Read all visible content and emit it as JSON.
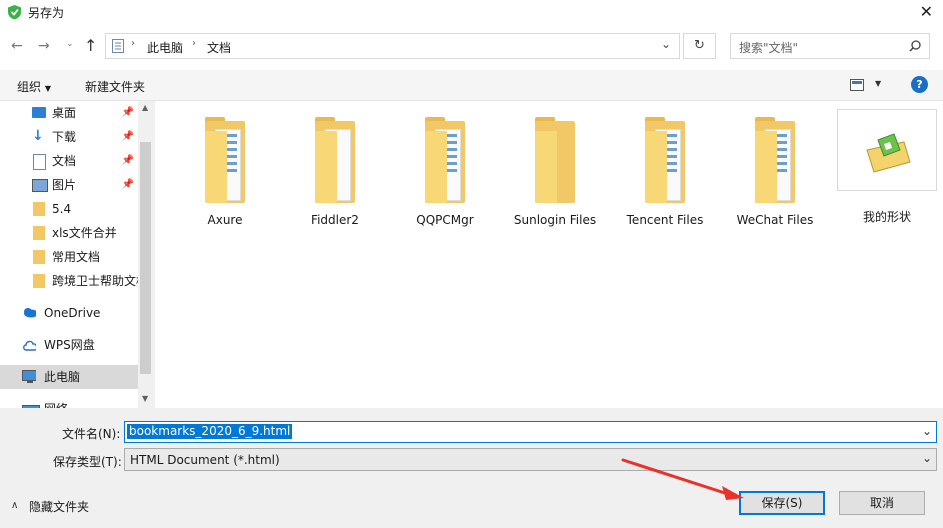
{
  "window": {
    "title": "另存为"
  },
  "nav": {
    "breadcrumb": [
      "此电脑",
      "文档"
    ],
    "search_placeholder": "搜索\"文档\""
  },
  "toolbar": {
    "organize": "组织",
    "new_folder": "新建文件夹"
  },
  "sidebar": {
    "items": [
      {
        "label": "桌面",
        "icon": "desktop-icon",
        "pinned": true
      },
      {
        "label": "下载",
        "icon": "download-icon",
        "pinned": true
      },
      {
        "label": "文档",
        "icon": "document-icon",
        "pinned": true
      },
      {
        "label": "图片",
        "icon": "picture-icon",
        "pinned": true
      },
      {
        "label": "5.4",
        "icon": "folder-icon",
        "pinned": false
      },
      {
        "label": "xls文件合并",
        "icon": "folder-icon",
        "pinned": false
      },
      {
        "label": "常用文档",
        "icon": "folder-icon",
        "pinned": false
      },
      {
        "label": "跨境卫士帮助文档",
        "icon": "folder-icon",
        "pinned": false
      },
      {
        "label": "OneDrive",
        "icon": "onedrive-icon",
        "pinned": false
      },
      {
        "label": "WPS网盘",
        "icon": "wps-cloud-icon",
        "pinned": false
      },
      {
        "label": "此电脑",
        "icon": "this-pc-icon",
        "pinned": false,
        "selected": true
      },
      {
        "label": "网络",
        "icon": "network-icon",
        "pinned": false
      }
    ]
  },
  "files": [
    {
      "name": "Axure",
      "type": "folder-docs"
    },
    {
      "name": "Fiddler2",
      "type": "folder-blank"
    },
    {
      "name": "QQPCMgr",
      "type": "folder-docs"
    },
    {
      "name": "Sunlogin Files",
      "type": "folder-empty"
    },
    {
      "name": "Tencent Files",
      "type": "folder-docs"
    },
    {
      "name": "WeChat Files",
      "type": "folder-docs"
    },
    {
      "name": "我的形状",
      "type": "shapes-folder"
    }
  ],
  "form": {
    "filename_label": "文件名(N):",
    "filename_value": "bookmarks_2020_6_9.html",
    "filetype_label": "保存类型(T):",
    "filetype_value": "HTML Document (*.html)",
    "hide_folders": "隐藏文件夹",
    "save": "保存(S)",
    "cancel": "取消"
  },
  "colors": {
    "accent": "#0078d7",
    "arrow": "#e8322a",
    "folder": "#f1c865"
  }
}
